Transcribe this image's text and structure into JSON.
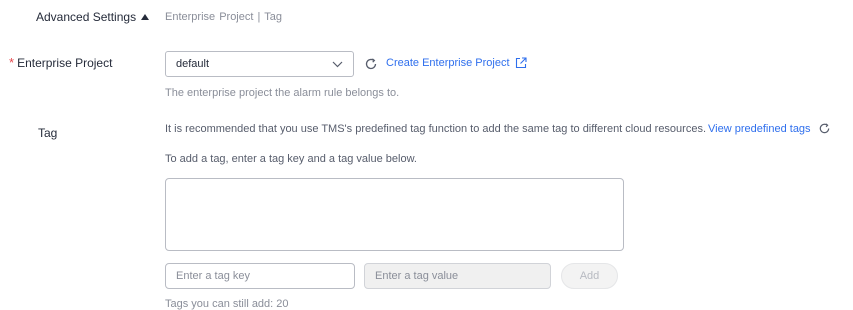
{
  "advanced": {
    "toggle_label": "Advanced Settings",
    "toggle_icon": "triangle-up-icon",
    "summary": "Enterprise Project | Tag"
  },
  "enterprise_project": {
    "required_mark": "*",
    "label": "Enterprise Project",
    "selected": "default",
    "dropdown_icon": "chevron-down-icon",
    "refresh_icon": "refresh-icon",
    "create_link": "Create Enterprise Project",
    "create_link_icon": "external-link-icon",
    "help": "The enterprise project the alarm rule belongs to."
  },
  "tag": {
    "label": "Tag",
    "recommend_text": "It is recommended that you use TMS's predefined tag function to add the same tag to different cloud resources.",
    "view_link": "View predefined tags",
    "refresh_icon": "refresh-icon",
    "instruction": "To add a tag, enter a tag key and a tag value below.",
    "key_placeholder": "Enter a tag key",
    "value_placeholder": "Enter a tag value",
    "add_label": "Add",
    "remaining": "Tags you can still add: 20"
  },
  "colors": {
    "link": "#2f6fed",
    "required": "#e5484d",
    "muted_text": "#8a8e99",
    "border": "#b9bcc4"
  }
}
